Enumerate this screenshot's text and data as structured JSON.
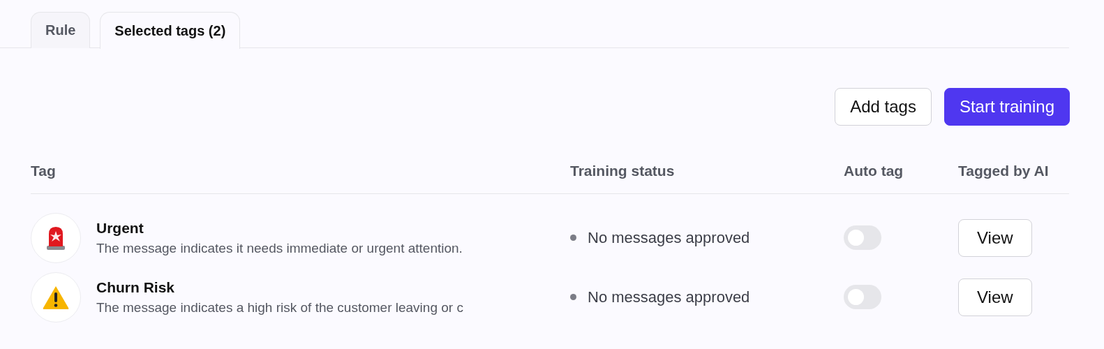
{
  "tabs": [
    {
      "label": "Rule",
      "selected": false
    },
    {
      "label": "Selected tags (2)",
      "selected": true
    }
  ],
  "actions": [
    {
      "label": "Add tags",
      "kind": "secondary"
    },
    {
      "label": "Start training",
      "kind": "primary"
    }
  ],
  "table": {
    "columns": [
      "Tag",
      "Training status",
      "Auto tag",
      "Tagged by AI"
    ],
    "rows": [
      {
        "kind": "siren",
        "name": "Urgent",
        "description": "The message indicates it needs immediate or urgent attention.",
        "status": "No messages approved",
        "auto_tag": false,
        "action": "View"
      },
      {
        "kind": "warning",
        "name": "Churn Risk",
        "description": "The message indicates a high risk of the customer leaving or c",
        "status": "No messages approved",
        "auto_tag": false,
        "action": "View"
      }
    ]
  }
}
